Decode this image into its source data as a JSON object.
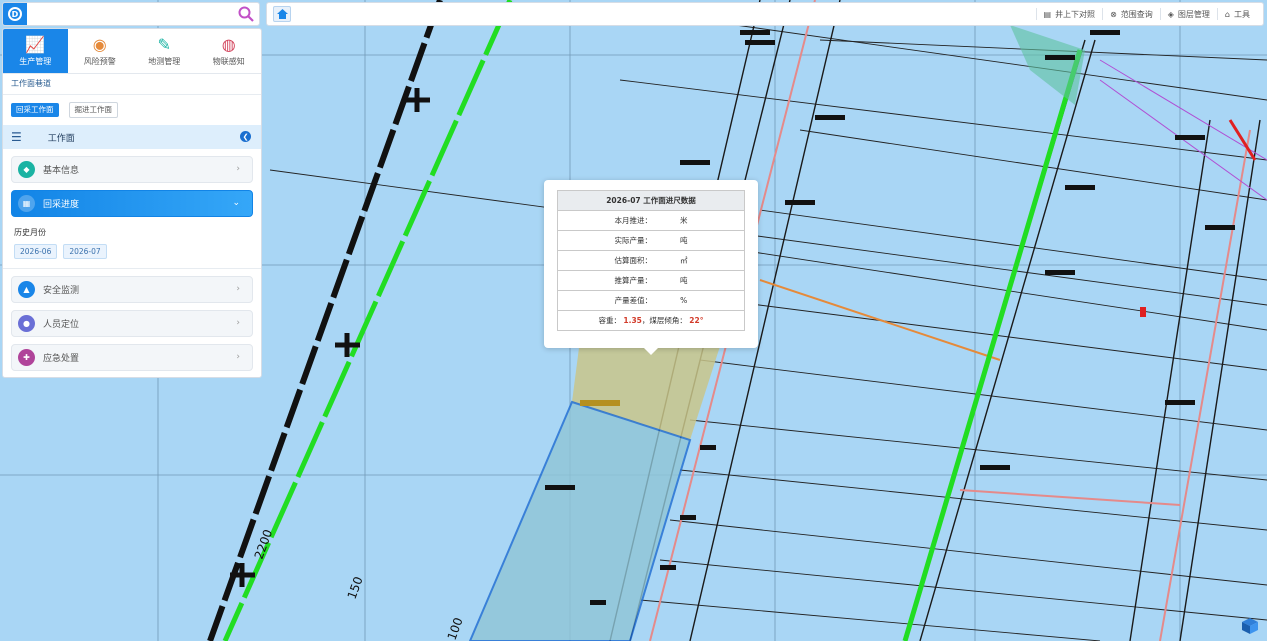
{
  "search": {
    "placeholder": ""
  },
  "logo": {
    "text": "D"
  },
  "toolbar": {
    "items": [
      {
        "icon": "layers-icon",
        "label": "井上下对照"
      },
      {
        "icon": "close-circle-icon",
        "label": "范围查询"
      },
      {
        "icon": "stack-icon",
        "label": "图层管理"
      },
      {
        "icon": "toolbox-icon",
        "label": "工具"
      }
    ]
  },
  "nav": {
    "tabs": [
      {
        "label": "生产管理",
        "icon": "chart-up-icon",
        "active": true
      },
      {
        "label": "风险预警",
        "icon": "risk-icon",
        "active": false
      },
      {
        "label": "地测管理",
        "icon": "survey-icon",
        "active": false
      },
      {
        "label": "物联感知",
        "icon": "globe-icon",
        "active": false
      }
    ]
  },
  "panel": {
    "section_title": "工作面巷道",
    "btn_mining": "回采工作面",
    "btn_tunneling": "掘进工作面",
    "header_title": "工作面",
    "items": {
      "basic": "基本信息",
      "progress": "回采进度",
      "safety": "安全监测",
      "personnel": "人员定位",
      "emergency": "应急处置"
    },
    "history_label": "历史月份",
    "months": [
      "2026-06",
      "2026-07"
    ]
  },
  "popup": {
    "title": "2026-07 工作面进尺数据",
    "advance_label": "本月推进：",
    "advance_unit": "米",
    "actual_label": "实际产量：",
    "actual_unit": "吨",
    "area_label": "估算面积：",
    "area_unit": "㎡",
    "estimated_label": "推算产量：",
    "estimated_unit": "吨",
    "diff_label": "产量差值：",
    "diff_unit": "%",
    "density_label": "容重：",
    "density_value": "1.35",
    "sep": "，",
    "dip_label": "煤层倾角：",
    "dip_value": "22°"
  },
  "map": {
    "labels": [
      "2200",
      "150",
      "100"
    ]
  },
  "colors": {
    "accent": "#1a86e8",
    "map_bg": "#a9d6f5",
    "green_line": "#22dd22",
    "highlight": "#d23b2a"
  }
}
